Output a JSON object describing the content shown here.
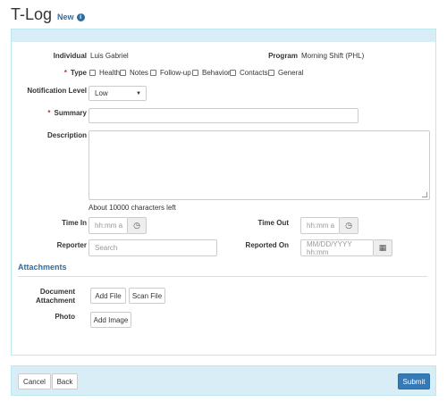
{
  "header": {
    "title": "T-Log",
    "badge": "New",
    "info_icon": "info-icon"
  },
  "form": {
    "individual": {
      "label": "Individual",
      "value": "Luis Gabriel"
    },
    "program": {
      "label": "Program",
      "value": "Morning Shift (PHL)"
    },
    "type": {
      "label": "Type",
      "required_mark": "*",
      "options": [
        "Health",
        "Notes",
        "Follow-up",
        "Behavior",
        "Contacts",
        "General"
      ]
    },
    "notification_level": {
      "label": "Notification Level",
      "value": "Low"
    },
    "summary": {
      "label": "Summary",
      "required_mark": "*",
      "value": ""
    },
    "description": {
      "label": "Description",
      "value": "",
      "chars_left": "About 10000 characters left"
    },
    "time_in": {
      "label": "Time In",
      "placeholder": "hh:mm a"
    },
    "time_out": {
      "label": "Time Out",
      "placeholder": "hh:mm a"
    },
    "reporter": {
      "label": "Reporter",
      "placeholder": "Search"
    },
    "reported_on": {
      "label": "Reported On",
      "placeholder": "MM/DD/YYYY hh:mm"
    }
  },
  "attachments": {
    "title": "Attachments",
    "document_label_line1": "Document",
    "document_label_line2": "Attachment",
    "add_file": "Add File",
    "scan_file": "Scan File",
    "photo_label": "Photo",
    "add_image": "Add Image"
  },
  "footer": {
    "cancel": "Cancel",
    "back": "Back",
    "submit": "Submit"
  },
  "colors": {
    "accent": "#337ab7",
    "panel_head": "#d9edf7",
    "required": "#c9302c"
  }
}
